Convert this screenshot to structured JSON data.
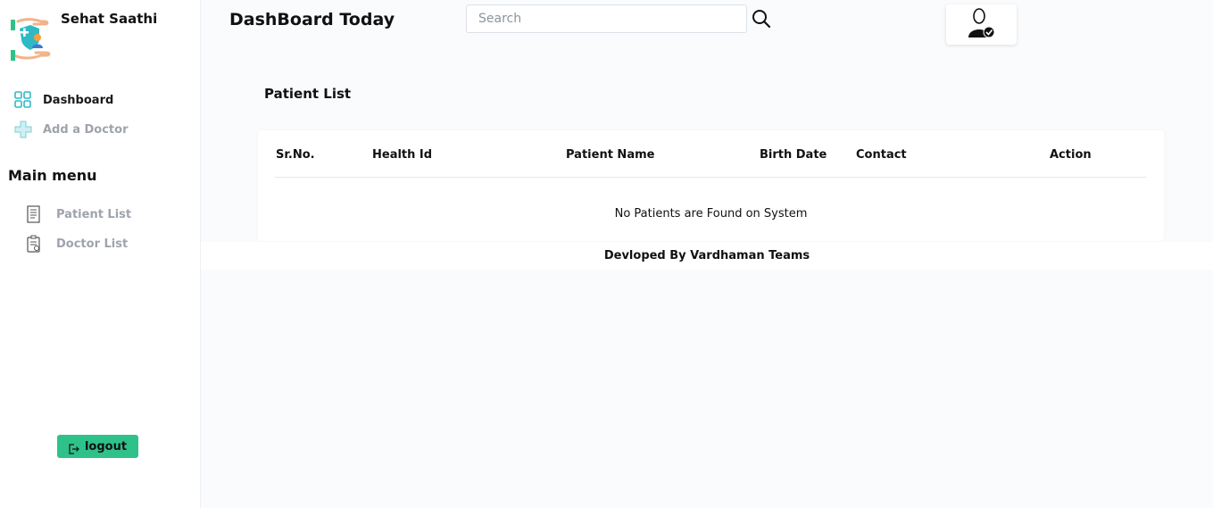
{
  "app": {
    "brand_name": "Sehat Saathi"
  },
  "sidebar": {
    "nav": [
      {
        "label": "Dashboard",
        "icon": "dashboard-grid-icon"
      },
      {
        "label": "Add a Doctor",
        "icon": "medical-cross-icon"
      }
    ],
    "menu_heading": "Main menu",
    "menu": [
      {
        "label": "Patient List",
        "icon": "list-document-icon"
      },
      {
        "label": "Doctor List",
        "icon": "clipboard-icon"
      }
    ],
    "logout_label": "logout"
  },
  "header": {
    "title": "DashBoard Today",
    "search_placeholder": "Search"
  },
  "main": {
    "section_title": "Patient List",
    "table": {
      "columns": [
        "Sr.No.",
        "Health Id",
        "Patient Name",
        "Birth Date",
        "Contact",
        "Action"
      ],
      "rows": [],
      "empty_message": "No Patients are Found on System"
    }
  },
  "footer": {
    "text": "Devloped By Vardhaman Teams"
  },
  "colors": {
    "accent": "#2ec28a",
    "icon_teal": "#2fb9c4",
    "muted_text": "#9ea3ad",
    "page_bg": "#fafbfd"
  }
}
